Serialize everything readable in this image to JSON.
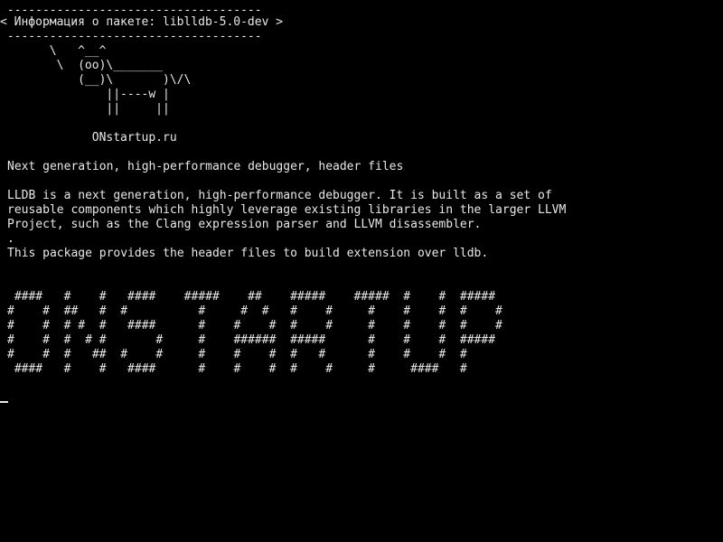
{
  "terminal": {
    "cowsay": {
      "bubble_top": " ------------------------------------",
      "bubble_text": "< Информация о пакете: liblldb-5.0-dev >",
      "bubble_bottom": " ------------------------------------",
      "cow_line1": "       \\   ^__^",
      "cow_line2": "        \\  (oo)\\_______",
      "cow_line3": "           (__)\\       )\\/\\",
      "cow_line4": "               ||----w |",
      "cow_line5": "               ||     ||"
    },
    "site": "             ONstartup.ru",
    "summary": "Next generation, high-performance debugger, header files",
    "description": [
      "LLDB is a next generation, high-performance debugger. It is built as a set of",
      "reusable components which highly leverage existing libraries in the larger LLVM",
      "Project, such as the Clang expression parser and LLVM disassembler.",
      ".",
      "This package provides the header files to build extension over lldb."
    ],
    "banner": [
      " ####   #    #   ####    #####    ##    #####    #####  #    #  #####",
      "#    #  ##   #  #          #     #  #   #    #     #    #    #  #    #",
      "#    #  # #  #   ####      #    #    #  #    #     #    #    #  #    #",
      "#    #  #  # #       #     #    ######  #####      #    #    #  #####",
      "#    #  #   ##  #    #     #    #    #  #   #      #    #    #  #",
      " ####   #    #   ####      #    #    #  #    #     #     ####   #"
    ]
  }
}
